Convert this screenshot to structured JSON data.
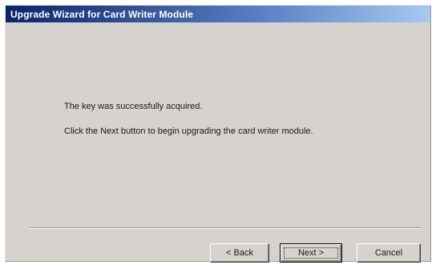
{
  "window": {
    "title": "Upgrade Wizard for Card Writer Module"
  },
  "content": {
    "message_1": "The key was successfully acquired.",
    "message_2": "Click the Next button to begin upgrading the card writer module."
  },
  "buttons": {
    "back_label": "< Back",
    "next_label": "Next >",
    "cancel_label": "Cancel"
  },
  "colors": {
    "titlebar_start": "#0a246a",
    "titlebar_end": "#a6caf0",
    "dialog_face": "#d6d3ce"
  }
}
